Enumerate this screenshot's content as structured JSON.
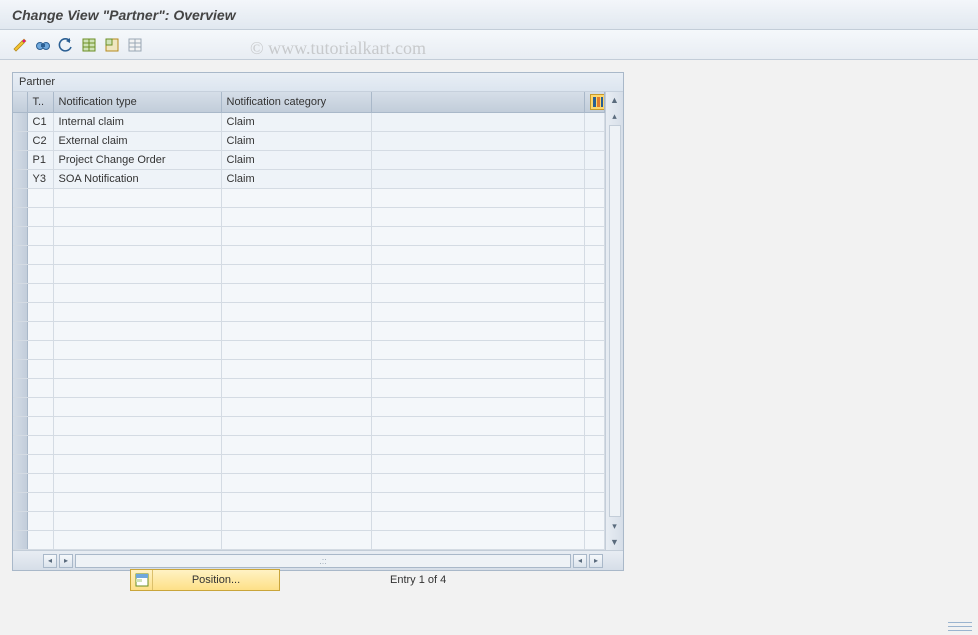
{
  "titlebar": {
    "text": "Change View \"Partner\": Overview"
  },
  "toolbar": {
    "icons": [
      "toggle-icon",
      "binoculars-icon",
      "undo-icon",
      "select-all-icon",
      "select-block-icon",
      "deselect-icon"
    ]
  },
  "watermark": "© www.tutorialkart.com",
  "table": {
    "group_title": "Partner",
    "columns": {
      "c0": "T..",
      "c1": "Notification type",
      "c2": "Notification category"
    },
    "rows": [
      {
        "t": "C1",
        "ntype": "Internal claim",
        "ncat": "Claim"
      },
      {
        "t": "C2",
        "ntype": "External claim",
        "ncat": "Claim"
      },
      {
        "t": "P1",
        "ntype": "Project Change Order",
        "ncat": "Claim"
      },
      {
        "t": "Y3",
        "ntype": "SOA Notification",
        "ncat": "Claim"
      }
    ],
    "hscroll_placeholder": ".::"
  },
  "footer": {
    "position_label": "Position...",
    "entry_text": "Entry 1 of 4"
  }
}
